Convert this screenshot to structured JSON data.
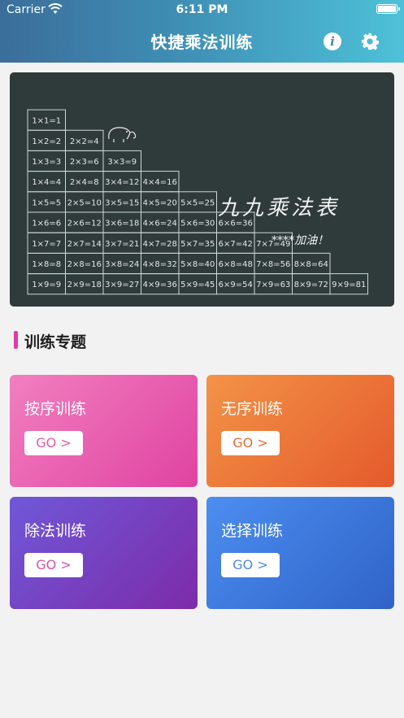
{
  "status_bar": {
    "carrier": "Carrier",
    "time": "6:11 PM"
  },
  "header": {
    "title": "快捷乘法训练",
    "info_icon": "i"
  },
  "banner": {
    "title": "九九乘法表",
    "subtitle": "****加油！",
    "table": [
      [
        "1×1=1"
      ],
      [
        "1×2=2",
        "2×2=4"
      ],
      [
        "1×3=3",
        "2×3=6",
        "3×3=9"
      ],
      [
        "1×4=4",
        "2×4=8",
        "3×4=12",
        "4×4=16"
      ],
      [
        "1×5=5",
        "2×5=10",
        "3×5=15",
        "4×5=20",
        "5×5=25"
      ],
      [
        "1×6=6",
        "2×6=12",
        "3×6=18",
        "4×6=24",
        "5×6=30",
        "6×6=36"
      ],
      [
        "1×7=7",
        "2×7=14",
        "3×7=21",
        "4×7=28",
        "5×7=35",
        "6×7=42",
        "7×7=49"
      ],
      [
        "1×8=8",
        "2×8=16",
        "3×8=24",
        "4×8=32",
        "5×8=40",
        "6×8=48",
        "7×8=56",
        "8×8=64"
      ],
      [
        "1×9=9",
        "2×9=18",
        "3×9=27",
        "4×9=36",
        "5×9=45",
        "6×9=54",
        "7×9=63",
        "8×9=72",
        "9×9=81"
      ]
    ]
  },
  "section": {
    "title": "训练专题"
  },
  "cards": [
    {
      "label": "按序训练",
      "button": "GO >"
    },
    {
      "label": "无序训练",
      "button": "GO >"
    },
    {
      "label": "除法训练",
      "button": "GO >"
    },
    {
      "label": "选择训练",
      "button": "GO >"
    }
  ],
  "colors": {
    "accent": "#e33aa8",
    "card1": "#e043a1",
    "card2": "#e45a2c",
    "card3": "#7d2ba9",
    "card4": "#3063c8"
  }
}
